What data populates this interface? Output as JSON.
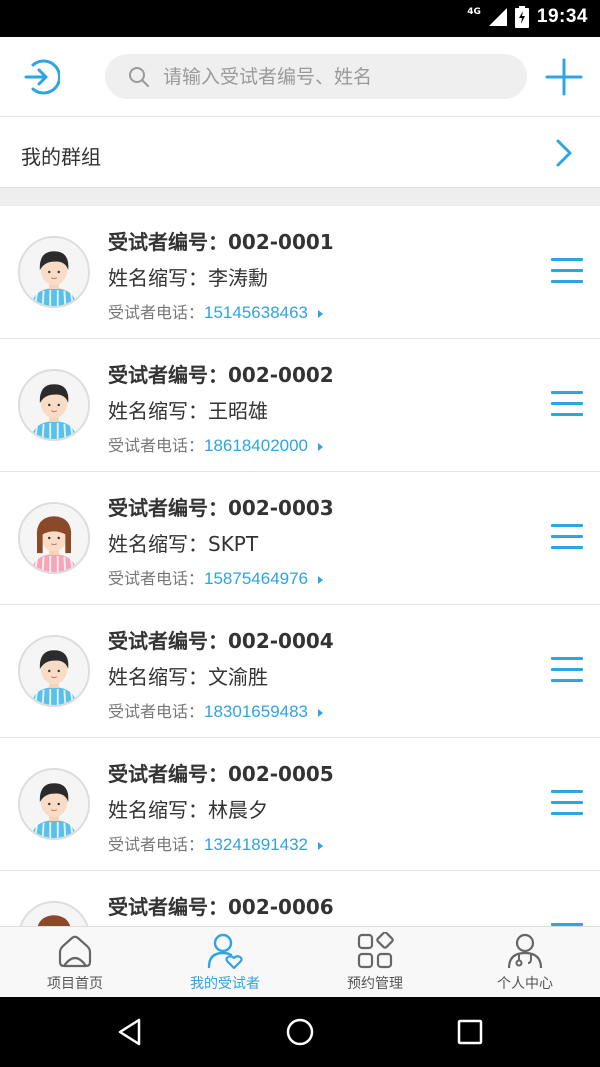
{
  "status": {
    "network": "4G",
    "time": "19:34"
  },
  "header": {
    "search_placeholder": "请输入受试者编号、姓名"
  },
  "group": {
    "label": "我的群组"
  },
  "subjects": [
    {
      "code_label": "受试者编号：002-0001",
      "name_label": "姓名缩写：李涛勳",
      "phone_prefix": "受试者电话：",
      "phone": "15145638463",
      "gender": "male"
    },
    {
      "code_label": "受试者编号：002-0002",
      "name_label": "姓名缩写：王昭雄",
      "phone_prefix": "受试者电话：",
      "phone": "18618402000",
      "gender": "male"
    },
    {
      "code_label": "受试者编号：002-0003",
      "name_label": "姓名缩写：SKPT",
      "phone_prefix": "受试者电话：",
      "phone": "15875464976",
      "gender": "female"
    },
    {
      "code_label": "受试者编号：002-0004",
      "name_label": "姓名缩写：文渝胜",
      "phone_prefix": "受试者电话：",
      "phone": "18301659483",
      "gender": "male"
    },
    {
      "code_label": "受试者编号：002-0005",
      "name_label": "姓名缩写：林晨夕",
      "phone_prefix": "受试者电话：",
      "phone": "13241891432",
      "gender": "male"
    },
    {
      "code_label": "受试者编号：002-0006",
      "name_label": "",
      "phone_prefix": "",
      "phone": "",
      "gender": "female"
    }
  ],
  "tabs": [
    {
      "label": "项目首页",
      "icon": "home-icon",
      "active": false
    },
    {
      "label": "我的受试者",
      "icon": "subject-icon",
      "active": true
    },
    {
      "label": "预约管理",
      "icon": "grid-icon",
      "active": false
    },
    {
      "label": "个人中心",
      "icon": "doctor-icon",
      "active": false
    }
  ],
  "colors": {
    "accent": "#2fa4e2",
    "male_shirt": "#5bc0e8",
    "female_shirt": "#f3a6b8",
    "hair": "#2b2b2b",
    "female_hair": "#8a4a2a"
  }
}
